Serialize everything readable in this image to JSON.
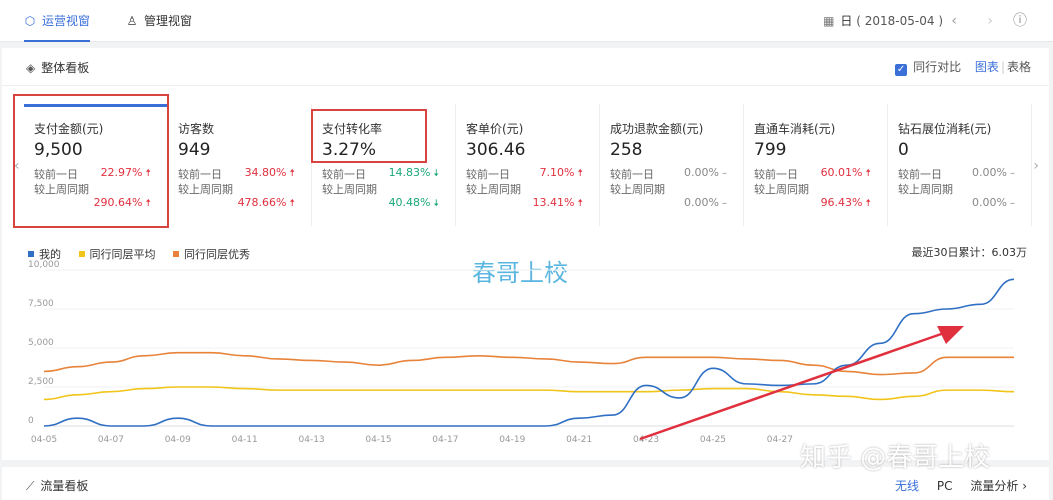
{
  "topbar": {
    "tabs": [
      {
        "label": "运营视窗",
        "icon": "shield-icon",
        "active": true
      },
      {
        "label": "管理视窗",
        "icon": "person-icon",
        "active": false
      }
    ],
    "date_mode": "日",
    "date": "( 2018-05-04 )"
  },
  "overview": {
    "title": "整体看板",
    "compare_label": "同行对比",
    "view_chart": "图表",
    "view_table": "表格"
  },
  "kpis": [
    {
      "label": "支付金额(元)",
      "value": "9,500",
      "day_label": "较前一日",
      "day_pct": "22.97%",
      "day_dir": "up",
      "week_label": "较上周同期",
      "week_pct": "290.64%",
      "week_dir": "up"
    },
    {
      "label": "访客数",
      "value": "949",
      "day_label": "较前一日",
      "day_pct": "34.80%",
      "day_dir": "up",
      "week_label": "较上周同期",
      "week_pct": "478.66%",
      "week_dir": "up"
    },
    {
      "label": "支付转化率",
      "value": "3.27%",
      "day_label": "较前一日",
      "day_pct": "14.83%",
      "day_dir": "down",
      "week_label": "较上周同期",
      "week_pct": "40.48%",
      "week_dir": "down"
    },
    {
      "label": "客单价(元)",
      "value": "306.46",
      "day_label": "较前一日",
      "day_pct": "7.10%",
      "day_dir": "up",
      "week_label": "较上周同期",
      "week_pct": "13.41%",
      "week_dir": "up"
    },
    {
      "label": "成功退款金额(元)",
      "value": "258",
      "day_label": "较前一日",
      "day_pct": "0.00%",
      "day_dir": "flat",
      "week_label": "较上周同期",
      "week_pct": "0.00%",
      "week_dir": "flat"
    },
    {
      "label": "直通车消耗(元)",
      "value": "799",
      "day_label": "较前一日",
      "day_pct": "60.01%",
      "day_dir": "up",
      "week_label": "较上周同期",
      "week_pct": "96.43%",
      "week_dir": "up"
    },
    {
      "label": "钻石展位消耗(元)",
      "value": "0",
      "day_label": "较前一日",
      "day_pct": "0.00%",
      "day_dir": "flat",
      "week_label": "较上周同期",
      "week_pct": "0.00%",
      "week_dir": "flat"
    }
  ],
  "chart_legend": [
    {
      "name": "我的",
      "color": "#2f6fc4"
    },
    {
      "name": "同行同层平均",
      "color": "#f0c419"
    },
    {
      "name": "同行同层优秀",
      "color": "#e8833a"
    }
  ],
  "chart_total": "最近30日累计：6.03万",
  "watermark": "春哥上校",
  "chart_data": {
    "type": "line",
    "x": [
      "04-05",
      "04-06",
      "04-07",
      "04-08",
      "04-09",
      "04-10",
      "04-11",
      "04-12",
      "04-13",
      "04-14",
      "04-15",
      "04-16",
      "04-17",
      "04-18",
      "04-19",
      "04-20",
      "04-21",
      "04-22",
      "04-23",
      "04-24",
      "04-25",
      "04-26",
      "04-27",
      "04-28",
      "04-29",
      "04-30",
      "05-01",
      "05-02",
      "05-03",
      "05-04"
    ],
    "x_tick_labels": [
      "04-05",
      "04-07",
      "04-09",
      "04-11",
      "04-13",
      "04-15",
      "04-17",
      "04-19",
      "04-21",
      "04-23",
      "04-25",
      "04-27"
    ],
    "y_tick_labels": [
      "10,000",
      "7,500",
      "5,000",
      "2,500",
      "0"
    ],
    "ylim": [
      0,
      10000
    ],
    "series": [
      {
        "name": "我的",
        "color": "#2f6fc4",
        "values": [
          0,
          500,
          0,
          0,
          500,
          0,
          0,
          0,
          0,
          0,
          0,
          0,
          0,
          0,
          0,
          0,
          500,
          700,
          2600,
          1800,
          3700,
          2700,
          2600,
          2700,
          3900,
          5300,
          7200,
          7500,
          7800,
          9400
        ]
      },
      {
        "name": "同行同层平均",
        "color": "#f0c419",
        "values": [
          1700,
          2000,
          2200,
          2400,
          2500,
          2500,
          2400,
          2300,
          2300,
          2300,
          2300,
          2300,
          2300,
          2300,
          2300,
          2300,
          2200,
          2200,
          2200,
          2300,
          2400,
          2400,
          2200,
          2000,
          1900,
          1700,
          1900,
          2300,
          2300,
          2200
        ]
      },
      {
        "name": "同行同层优秀",
        "color": "#e8833a",
        "values": [
          3500,
          3800,
          4100,
          4500,
          4700,
          4700,
          4500,
          4300,
          4200,
          4100,
          3900,
          4200,
          4400,
          4500,
          4400,
          4300,
          4100,
          4000,
          4400,
          4400,
          4400,
          4300,
          4200,
          3900,
          3500,
          3300,
          3400,
          4400,
          4400,
          4400
        ]
      }
    ]
  },
  "traffic": {
    "title": "流量看板",
    "wireless": "无线",
    "pc": "PC",
    "analysis": "流量分析"
  },
  "zhihu_watermark": "知乎 @春哥上校"
}
